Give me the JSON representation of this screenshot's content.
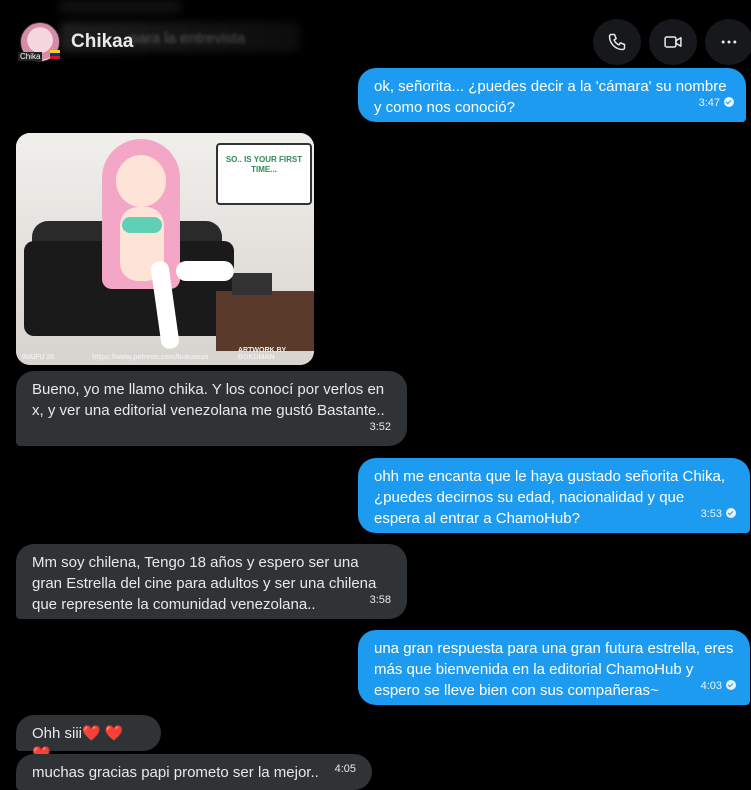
{
  "header": {
    "contact_name": "Chikaa",
    "blurred_text": "para la entrevista",
    "avatar_tag": "Chika"
  },
  "image_message": {
    "speech_text": "SO.. IS YOUR FIRST TIME...",
    "caption_left": "WAIFU 26",
    "caption_mid": "https://www.patreon.com/bokuman",
    "caption_right": "ARTWORK BY BOKUMAN"
  },
  "messages": [
    {
      "dir": "out",
      "text": "ok, señorita... ¿puedes decir a la 'cámara' su nombre y como nos conoció?",
      "time": "3:47"
    },
    {
      "dir": "in",
      "text": "Bueno, yo me llamo chika. Y los conocí por verlos en x, y ver una editorial venezolana me gustó Bastante..",
      "time": "3:52"
    },
    {
      "dir": "out",
      "text": "ohh me encanta que le haya gustado señorita Chika, ¿puedes decirnos su edad, nacionalidad y que espera al entrar a ChamoHub?",
      "time": "3:53"
    },
    {
      "dir": "in",
      "text": "Mm soy chilena, Tengo 18 años y espero ser una gran Estrella del cine para adultos y ser una chilena que represente la comunidad venezolana..",
      "time": "3:58"
    },
    {
      "dir": "out",
      "text": "una gran respuesta para una gran futura estrella, eres más que bienvenida en la editorial ChamoHub y espero se lleve bien con sus compañeras~",
      "time": "4:03"
    },
    {
      "dir": "in",
      "text": "Ohh siii❤️ ❤️ ❤️",
      "time": ""
    },
    {
      "dir": "in",
      "text": "muchas gracias papi prometo ser la mejor..",
      "time": "4:05"
    }
  ],
  "colors": {
    "outgoing_bubble": "#1d9bf0",
    "incoming_bubble": "#2f3336",
    "background": "#000000"
  },
  "icons": [
    "phone-icon",
    "video-camera-icon",
    "more-options-icon"
  ]
}
